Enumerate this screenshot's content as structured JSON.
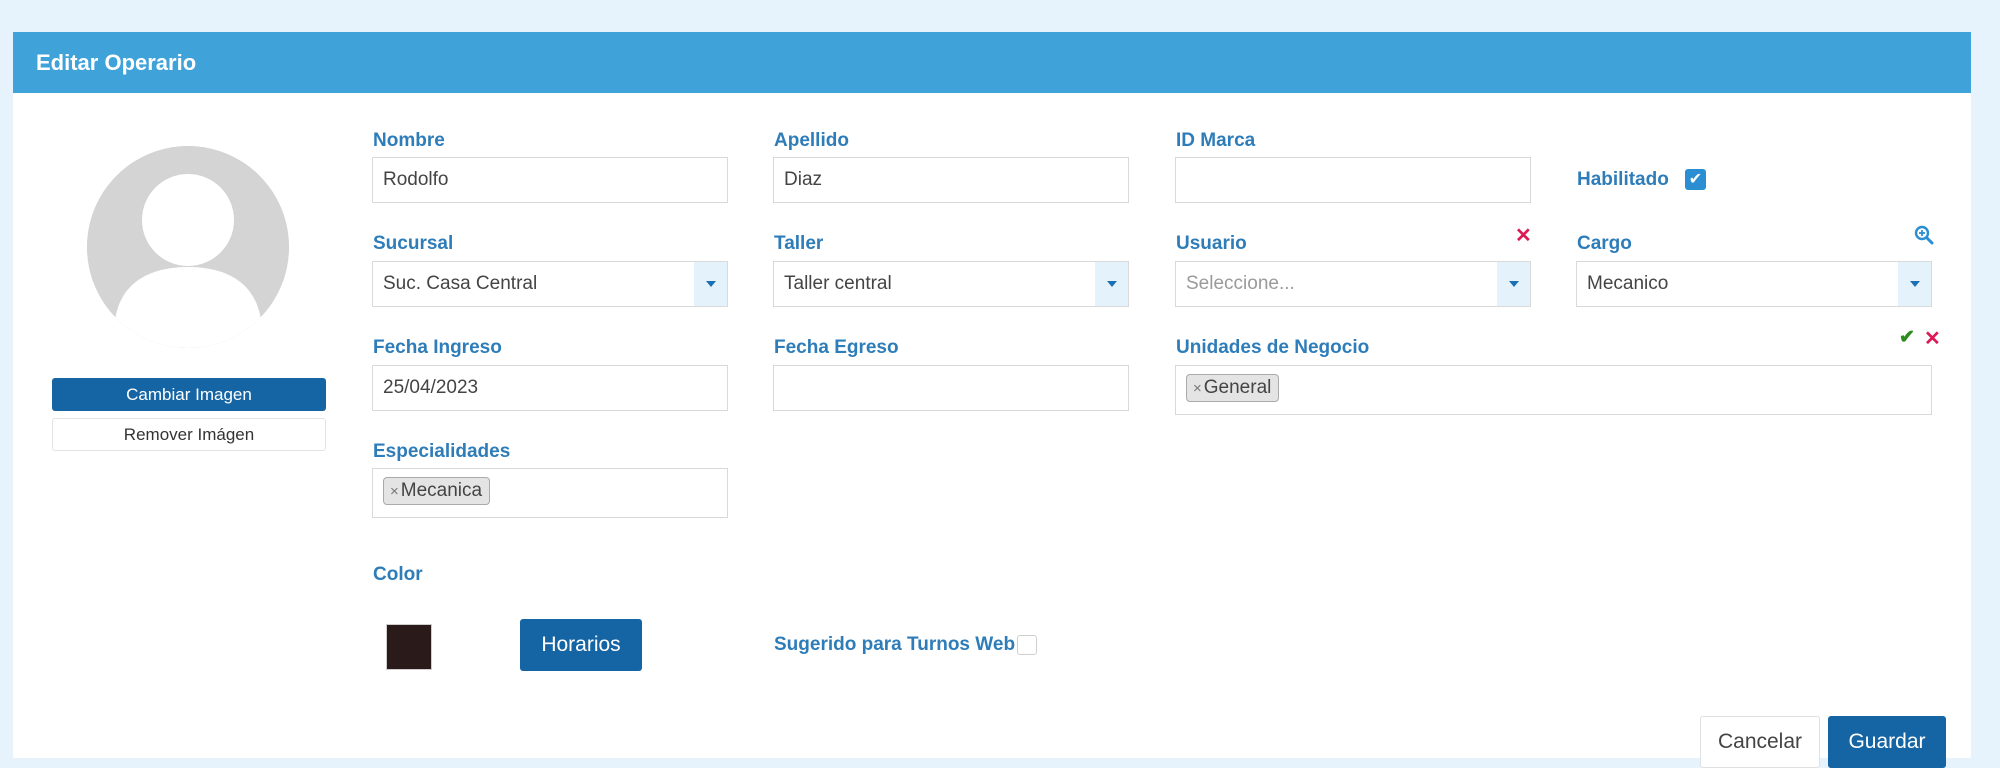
{
  "header": {
    "title": "Editar Operario"
  },
  "avatar": {
    "icon": "user-icon",
    "change_label": "Cambiar Imagen",
    "remove_label": "Remover Imágen"
  },
  "fields": {
    "nombre": {
      "label": "Nombre",
      "value": "Rodolfo"
    },
    "apellido": {
      "label": "Apellido",
      "value": "Diaz"
    },
    "id_marca": {
      "label": "ID Marca",
      "value": ""
    },
    "habilitado": {
      "label": "Habilitado",
      "checked": true
    },
    "sucursal": {
      "label": "Sucursal",
      "value": "Suc. Casa Central"
    },
    "taller": {
      "label": "Taller",
      "value": "Taller central"
    },
    "usuario": {
      "label": "Usuario",
      "placeholder": "Seleccione...",
      "clear_icon": "close-icon"
    },
    "cargo": {
      "label": "Cargo",
      "value": "Mecanico",
      "search_icon": "zoom-icon"
    },
    "fecha_ingreso": {
      "label": "Fecha Ingreso",
      "value": "25/04/2023"
    },
    "fecha_egreso": {
      "label": "Fecha Egreso",
      "value": ""
    },
    "unidades_negocio": {
      "label": "Unidades de Negocio",
      "tags": [
        "General"
      ]
    },
    "especialidades": {
      "label": "Especialidades",
      "tags": [
        "Mecanica"
      ]
    },
    "color": {
      "label": "Color",
      "value": "#2a1a1a"
    },
    "sugerido": {
      "label": "Sugerido para Turnos Web",
      "checked": false
    }
  },
  "buttons": {
    "horarios": "Horarios",
    "cancelar": "Cancelar",
    "guardar": "Guardar"
  },
  "colors": {
    "header": "#3fa2d9",
    "primary_button": "#1565a4",
    "label": "#2e7db9",
    "clear": "#dc1a55",
    "confirm": "#2e8b1e"
  }
}
